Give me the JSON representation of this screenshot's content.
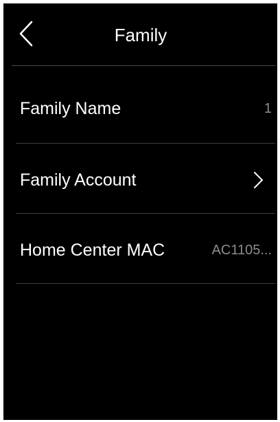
{
  "colors": {
    "background": "#000000",
    "text_primary": "#ffffff",
    "text_secondary": "#8c8c8c",
    "divider": "#3e3e3e"
  },
  "header": {
    "title": "Family",
    "back_icon": "chevron-left-icon"
  },
  "rows": [
    {
      "label": "Family Name",
      "value": "1"
    },
    {
      "label": "Family Account",
      "icon": "chevron-right-icon"
    },
    {
      "label": "Home Center MAC",
      "value": "AC1105..."
    }
  ]
}
